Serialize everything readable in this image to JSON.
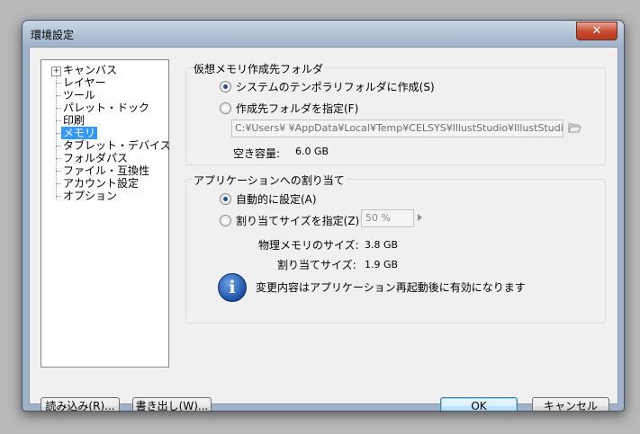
{
  "window": {
    "title": "環境設定",
    "close_label": "✕"
  },
  "tree": {
    "expander": "+",
    "items": [
      {
        "label": "キャンバス"
      },
      {
        "label": "レイヤー"
      },
      {
        "label": "ツール"
      },
      {
        "label": "パレット・ドック"
      },
      {
        "label": "印刷"
      },
      {
        "label": "メモリ",
        "selected": true
      },
      {
        "label": "タブレット・デバイス"
      },
      {
        "label": "フォルダパス"
      },
      {
        "label": "ファイル・互換性"
      },
      {
        "label": "アカウント設定"
      },
      {
        "label": "オプション"
      }
    ]
  },
  "vm_group": {
    "title": "仮想メモリ作成先フォルダ",
    "option_system": "システムのテンポラリフォルダに作成(S)",
    "option_custom": "作成先フォルダを指定(F)",
    "path": "C:¥Users¥            ¥AppData¥Local¥Temp¥CELSYS¥IllustStudio¥IllustStudio",
    "free_space_label": "空き容量:",
    "free_space_value": "6.0 GB",
    "selected": "system"
  },
  "alloc_group": {
    "title": "アプリケーションへの割り当て",
    "option_auto": "自動的に設定(A)",
    "option_size": "割り当てサイズを指定(Z)",
    "size_value": "50 %",
    "physical_label": "物理メモリのサイズ:",
    "physical_value": "3.8 GB",
    "alloc_label": "割り当てサイズ:",
    "alloc_value": "1.9 GB",
    "info_icon_letter": "i",
    "notice": "変更内容はアプリケーション再起動後に有効になります",
    "selected": "auto"
  },
  "buttons": {
    "load": "読み込み(R)...",
    "export": "書き出し(W)...",
    "ok": "OK",
    "cancel": "キャンセル"
  },
  "colors": {
    "selection": "#3399ff",
    "info_icon": "#1a4fa5"
  },
  "icons": {
    "folder": "folder-open-icon",
    "info": "info-icon",
    "close": "close-icon"
  }
}
